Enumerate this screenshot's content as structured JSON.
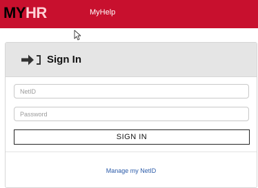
{
  "header": {
    "logo_part1": "MY",
    "logo_part2": "HR",
    "help_link": "MyHelp"
  },
  "signin": {
    "title": "Sign In",
    "netid_placeholder": "NetID",
    "password_placeholder": "Password",
    "button_label": "SIGN IN",
    "manage_link": "Manage my NetID"
  },
  "colors": {
    "brand_red": "#c8102e",
    "link_blue": "#2a5aa8",
    "header_gray": "#e5e5e5"
  },
  "icons": {
    "signin": "sign-in-icon",
    "cursor": "mouse-cursor-icon"
  }
}
